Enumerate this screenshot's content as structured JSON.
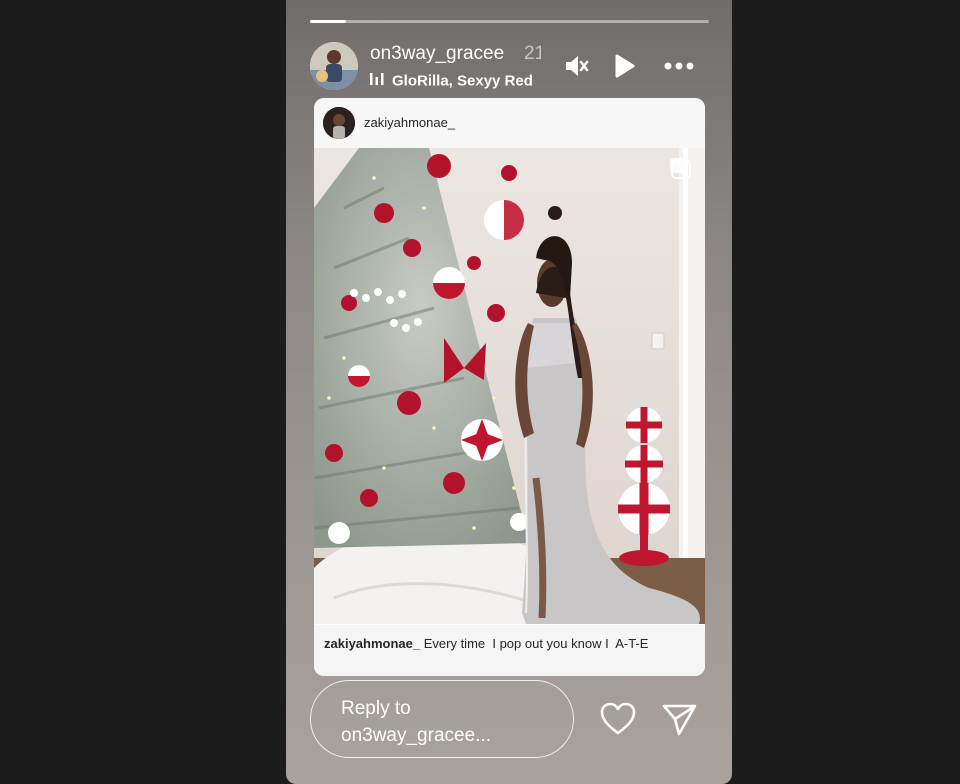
{
  "story": {
    "progress": 0.09,
    "username": "on3way_gracee",
    "time_fragment": "21",
    "music_label": "GloRilla, Sexyy Red"
  },
  "controls": [
    "mute-icon",
    "play-icon",
    "more-icon"
  ],
  "shared_post": {
    "username": "zakiyahmonae_",
    "caption_user": "zakiyahmonae_",
    "caption_text": " Every time  I pop out you know I  A-T-E"
  },
  "reply": {
    "line1": "Reply to",
    "line2": "on3way_gracee..."
  },
  "icons": [
    "heart-icon",
    "send-icon"
  ]
}
